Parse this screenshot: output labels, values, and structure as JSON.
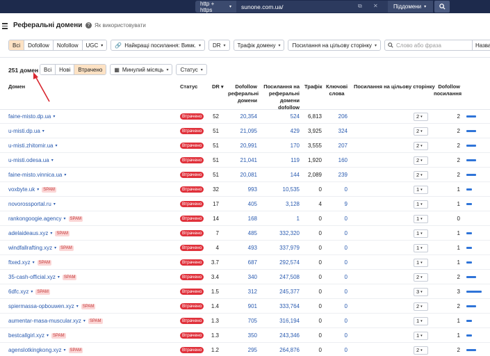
{
  "topbar": {
    "protocol": "http + https",
    "url": "sunone.com.ua/",
    "subdomains": "Піддомени",
    "colors": {
      "bg": "#1d2a4c"
    }
  },
  "page": {
    "title": "Реферальні домени",
    "help": "Як використовувати"
  },
  "filters": {
    "link_types": [
      "Всі",
      "Dofollow",
      "Nofollow",
      "UGC"
    ],
    "best_links": "Найкращі посилання: Вимк.",
    "dr": "DR",
    "traffic": "Трафік домену",
    "target_links": "Посилання на цільову сторінку",
    "search_placeholder": "Слово або фраза",
    "search_scope": "Назва до"
  },
  "summary": {
    "count": "251 домен",
    "tabs": [
      "Всі",
      "Нові",
      "Втрачено"
    ],
    "period": "Минулий місяць",
    "status": "Статус"
  },
  "columns": {
    "domain": "Домен",
    "status": "Статус",
    "dr": "DR",
    "dofollow_ref": [
      "Dofollow",
      "реферальні",
      "домени"
    ],
    "links_ref": [
      "Посилання на",
      "реферальні",
      "домени",
      "dofollow"
    ],
    "traffic": "Трафік",
    "keywords": [
      "Ключові",
      "слова"
    ],
    "target_links": "Посилання на цільову сторінку",
    "dofollow_links": [
      "Dofollow",
      "посилання"
    ]
  },
  "status_label": "Втрачено",
  "spam_label": "SPAM",
  "rows": [
    {
      "domain": "faine-misto.dp.ua",
      "spam": false,
      "dr": "52",
      "dofollow_ref": "20,354",
      "links": "524",
      "traffic": "6,813",
      "keywords": "206",
      "target": "2",
      "dofollow": "2",
      "bar": 0.55
    },
    {
      "domain": "u-misti.dp.ua",
      "spam": false,
      "dr": "51",
      "dofollow_ref": "21,095",
      "links": "429",
      "traffic": "3,925",
      "keywords": "324",
      "target": "2",
      "dofollow": "2",
      "bar": 0.55
    },
    {
      "domain": "u-misti.zhitomir.ua",
      "spam": false,
      "dr": "51",
      "dofollow_ref": "20,991",
      "links": "170",
      "traffic": "3,555",
      "keywords": "207",
      "target": "2",
      "dofollow": "2",
      "bar": 0.55
    },
    {
      "domain": "u-misti.odesa.ua",
      "spam": false,
      "dr": "51",
      "dofollow_ref": "21,041",
      "links": "119",
      "traffic": "1,920",
      "keywords": "160",
      "target": "2",
      "dofollow": "2",
      "bar": 0.55
    },
    {
      "domain": "faine-misto.vinnica.ua",
      "spam": false,
      "dr": "51",
      "dofollow_ref": "20,081",
      "links": "144",
      "traffic": "2,089",
      "keywords": "239",
      "target": "2",
      "dofollow": "2",
      "bar": 0.55
    },
    {
      "domain": "voxbyte.uk",
      "spam": true,
      "dr": "32",
      "dofollow_ref": "993",
      "links": "10,535",
      "traffic": "0",
      "keywords": "0",
      "target": "1",
      "dofollow": "1",
      "bar": 0.3
    },
    {
      "domain": "novorossportal.ru",
      "spam": false,
      "dr": "17",
      "dofollow_ref": "405",
      "links": "3,128",
      "traffic": "4",
      "keywords": "9",
      "target": "1",
      "dofollow": "1",
      "bar": 0.3
    },
    {
      "domain": "rankongoogie.agency",
      "spam": true,
      "dr": "14",
      "dofollow_ref": "168",
      "links": "1",
      "traffic": "0",
      "keywords": "0",
      "target": "1",
      "dofollow": "0",
      "bar": 0
    },
    {
      "domain": "adelaideaus.xyz",
      "spam": true,
      "dr": "7",
      "dofollow_ref": "485",
      "links": "332,320",
      "traffic": "0",
      "keywords": "0",
      "target": "1",
      "dofollow": "1",
      "bar": 0.3
    },
    {
      "domain": "windfallrafting.xyz",
      "spam": true,
      "dr": "4",
      "dofollow_ref": "493",
      "links": "337,979",
      "traffic": "0",
      "keywords": "0",
      "target": "1",
      "dofollow": "1",
      "bar": 0.3
    },
    {
      "domain": "ftxed.xyz",
      "spam": true,
      "dr": "3.7",
      "dofollow_ref": "687",
      "links": "292,574",
      "traffic": "0",
      "keywords": "0",
      "target": "1",
      "dofollow": "1",
      "bar": 0.3
    },
    {
      "domain": "35-cash-official.xyz",
      "spam": true,
      "dr": "3.4",
      "dofollow_ref": "340",
      "links": "247,508",
      "traffic": "0",
      "keywords": "0",
      "target": "2",
      "dofollow": "2",
      "bar": 0.55
    },
    {
      "domain": "6dfc.xyz",
      "spam": true,
      "dr": "1.5",
      "dofollow_ref": "312",
      "links": "245,377",
      "traffic": "0",
      "keywords": "0",
      "target": "3",
      "dofollow": "3",
      "bar": 0.85
    },
    {
      "domain": "spiermassa-opbouwen.xyz",
      "spam": true,
      "dr": "1.4",
      "dofollow_ref": "901",
      "links": "333,764",
      "traffic": "0",
      "keywords": "0",
      "target": "2",
      "dofollow": "2",
      "bar": 0.55
    },
    {
      "domain": "aumentar-masa-muscular.xyz",
      "spam": true,
      "dr": "1.3",
      "dofollow_ref": "705",
      "links": "316,194",
      "traffic": "0",
      "keywords": "0",
      "target": "1",
      "dofollow": "1",
      "bar": 0.3
    },
    {
      "domain": "bestcallgirl.xyz",
      "spam": true,
      "dr": "1.3",
      "dofollow_ref": "350",
      "links": "243,346",
      "traffic": "0",
      "keywords": "0",
      "target": "1",
      "dofollow": "1",
      "bar": 0.3
    },
    {
      "domain": "agenslotkingkong.xyz",
      "spam": true,
      "dr": "1.2",
      "dofollow_ref": "295",
      "links": "264,876",
      "traffic": "0",
      "keywords": "0",
      "target": "2",
      "dofollow": "2",
      "bar": 0.55
    }
  ]
}
